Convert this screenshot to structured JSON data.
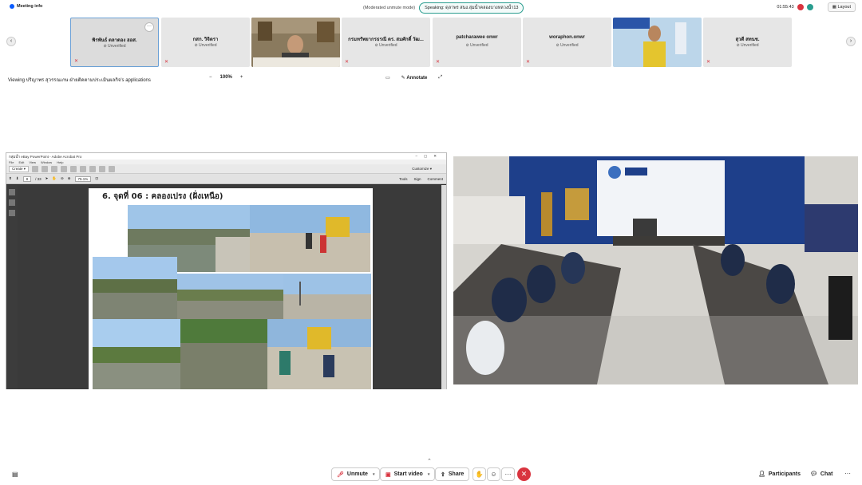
{
  "topbar": {
    "meeting_info": "Meeting info",
    "moderated_mode": "(Moderated unmute mode)",
    "speaking": "Speaking: ดุลาพร สนง.ลุ่มน้ำคลองบางหลวงน้ำ13",
    "time": "01:55:43",
    "layout": "Layout"
  },
  "participants": [
    {
      "name": "พิรพันธ์ ตลาดอง ฮอส.",
      "status": "Unverified",
      "selected": true
    },
    {
      "name": "กสก. วิจิตรา",
      "status": "Unverified"
    },
    {
      "name": "กรมทรัพยากรธรณี ดร. สมศักดิ์ วัฒ...",
      "status": "Unverified"
    },
    {
      "name": "patcharawee onwr",
      "status": "Unverified"
    },
    {
      "name": "woraphon.onwr",
      "status": "Unverified"
    },
    {
      "name": "สุวดี สทนช.",
      "status": "Unverified"
    }
  ],
  "viewbar": {
    "viewing": "Viewing ปริญาพร สุวรรณเกษ ฝ่ายติดตามประเมินผลกิจ's applications",
    "zoom_minus": "−",
    "zoom_level": "100%",
    "zoom_plus": "+",
    "annotate": "Annotate"
  },
  "acrobat": {
    "title": "กลุ่มน้ำ eBay PowerPoint - Adobe Acrobat Pro",
    "menu": [
      "File",
      "Edit",
      "View",
      "Window",
      "Help"
    ],
    "create": "Create",
    "customize": "Customize",
    "page_num": "8",
    "page_total": "/ 33",
    "zoom": "75.1%",
    "tools": "Tools",
    "sign": "Sign",
    "comment": "Comment"
  },
  "slide": {
    "title": "6.   จุดที่ 06 : คลองเปรง (ฝั่งเหนือ)"
  },
  "bottombar": {
    "unmute": "Unmute",
    "start_video": "Start video",
    "share": "Share",
    "participants": "Participants",
    "chat": "Chat"
  },
  "colors": {
    "accent": "#0b5cff",
    "leave_red": "#d9343f",
    "speaking_border": "#2a9d8f"
  }
}
